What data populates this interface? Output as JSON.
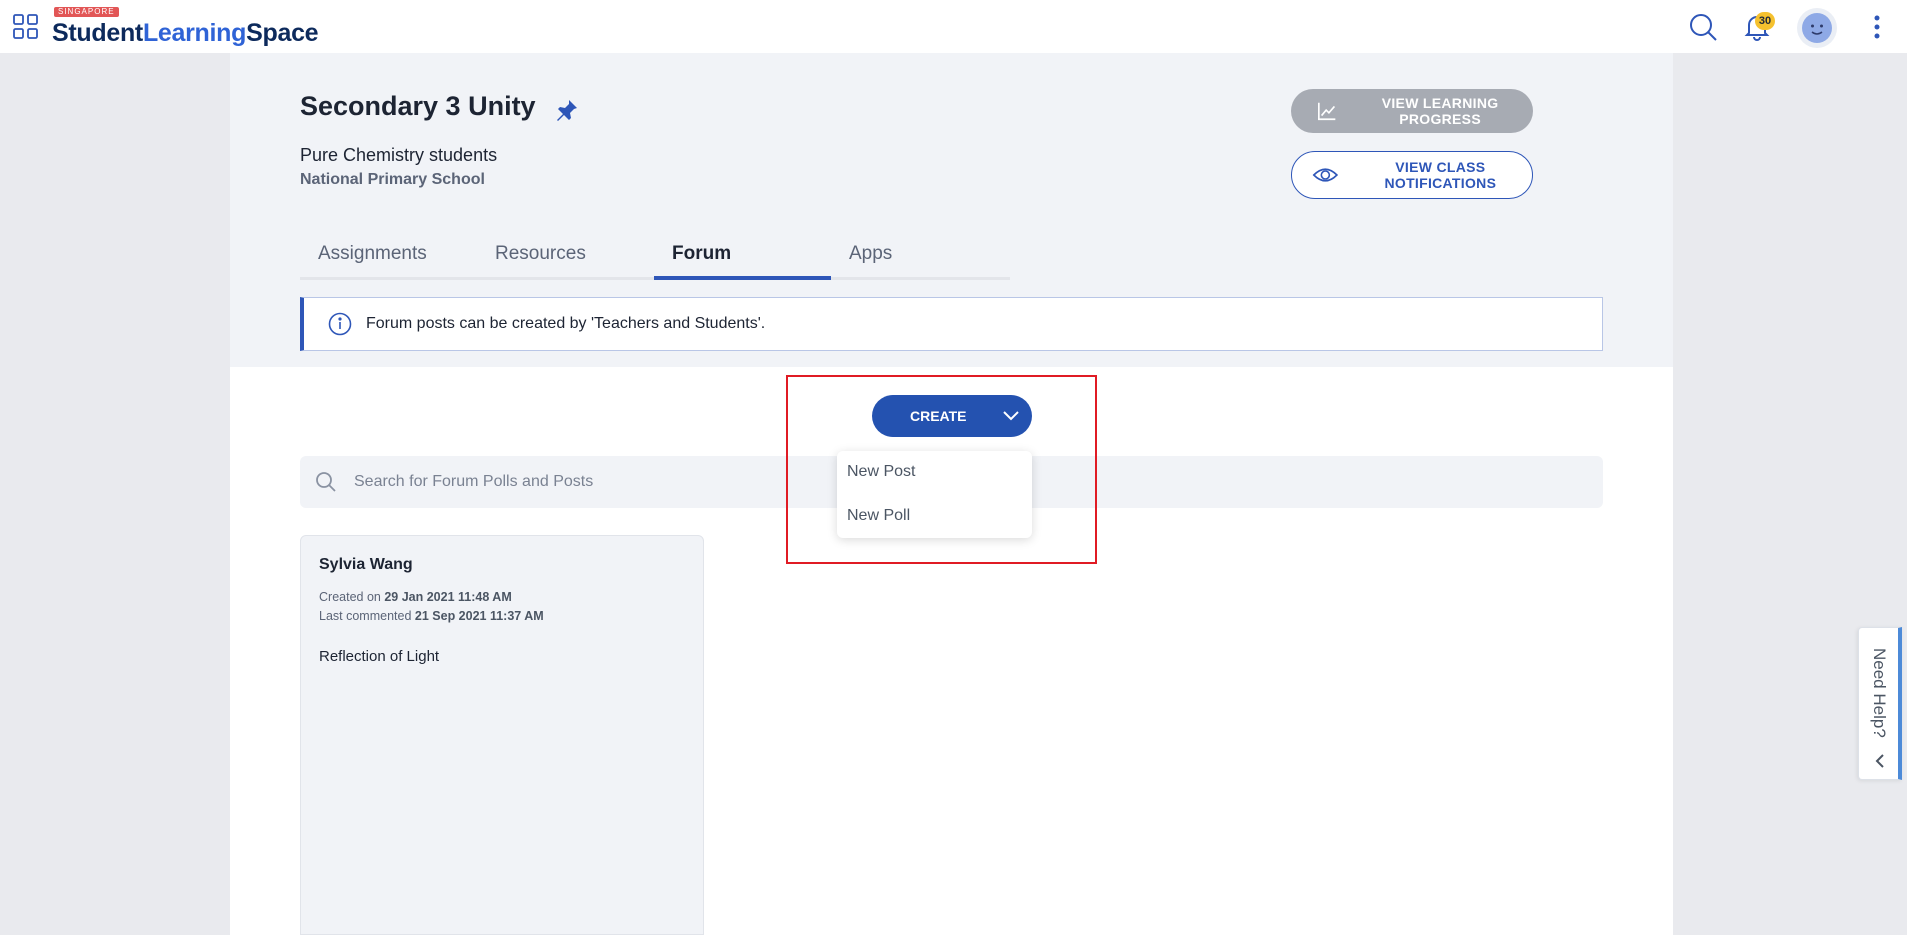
{
  "app": {
    "logo_tag": "SINGAPORE",
    "logo_word1": "Student",
    "logo_word2": "Learning",
    "logo_word3": "Space",
    "notification_count": "30"
  },
  "class_header": {
    "title": "Secondary 3 Unity",
    "subtitle": "Pure Chemistry students",
    "school": "National Primary School",
    "view_progress_label": "VIEW LEARNING PROGRESS",
    "view_notifications_label": "VIEW CLASS NOTIFICATIONS"
  },
  "tabs": [
    {
      "label": "Assignments",
      "active": false
    },
    {
      "label": "Resources",
      "active": false
    },
    {
      "label": "Forum",
      "active": true
    },
    {
      "label": "Apps",
      "active": false
    }
  ],
  "info_banner": {
    "text": "Forum posts can be created by 'Teachers and Students'."
  },
  "create_menu": {
    "button_label": "CREATE",
    "items": [
      "New Post",
      "New Poll"
    ]
  },
  "search": {
    "placeholder": "Search for Forum Polls and Posts",
    "value": ""
  },
  "posts": [
    {
      "author": "Sylvia Wang",
      "created_label": "Created on",
      "created_value": "29 Jan 2021 11:48 AM",
      "commented_label": "Last commented",
      "commented_value": "21 Sep 2021 11:37 AM",
      "title": "Reflection of Light"
    }
  ],
  "help": {
    "label": "Need Help?"
  },
  "colors": {
    "accent": "#2452b0",
    "badge": "#f5c12e",
    "highlight": "#e01b24"
  }
}
